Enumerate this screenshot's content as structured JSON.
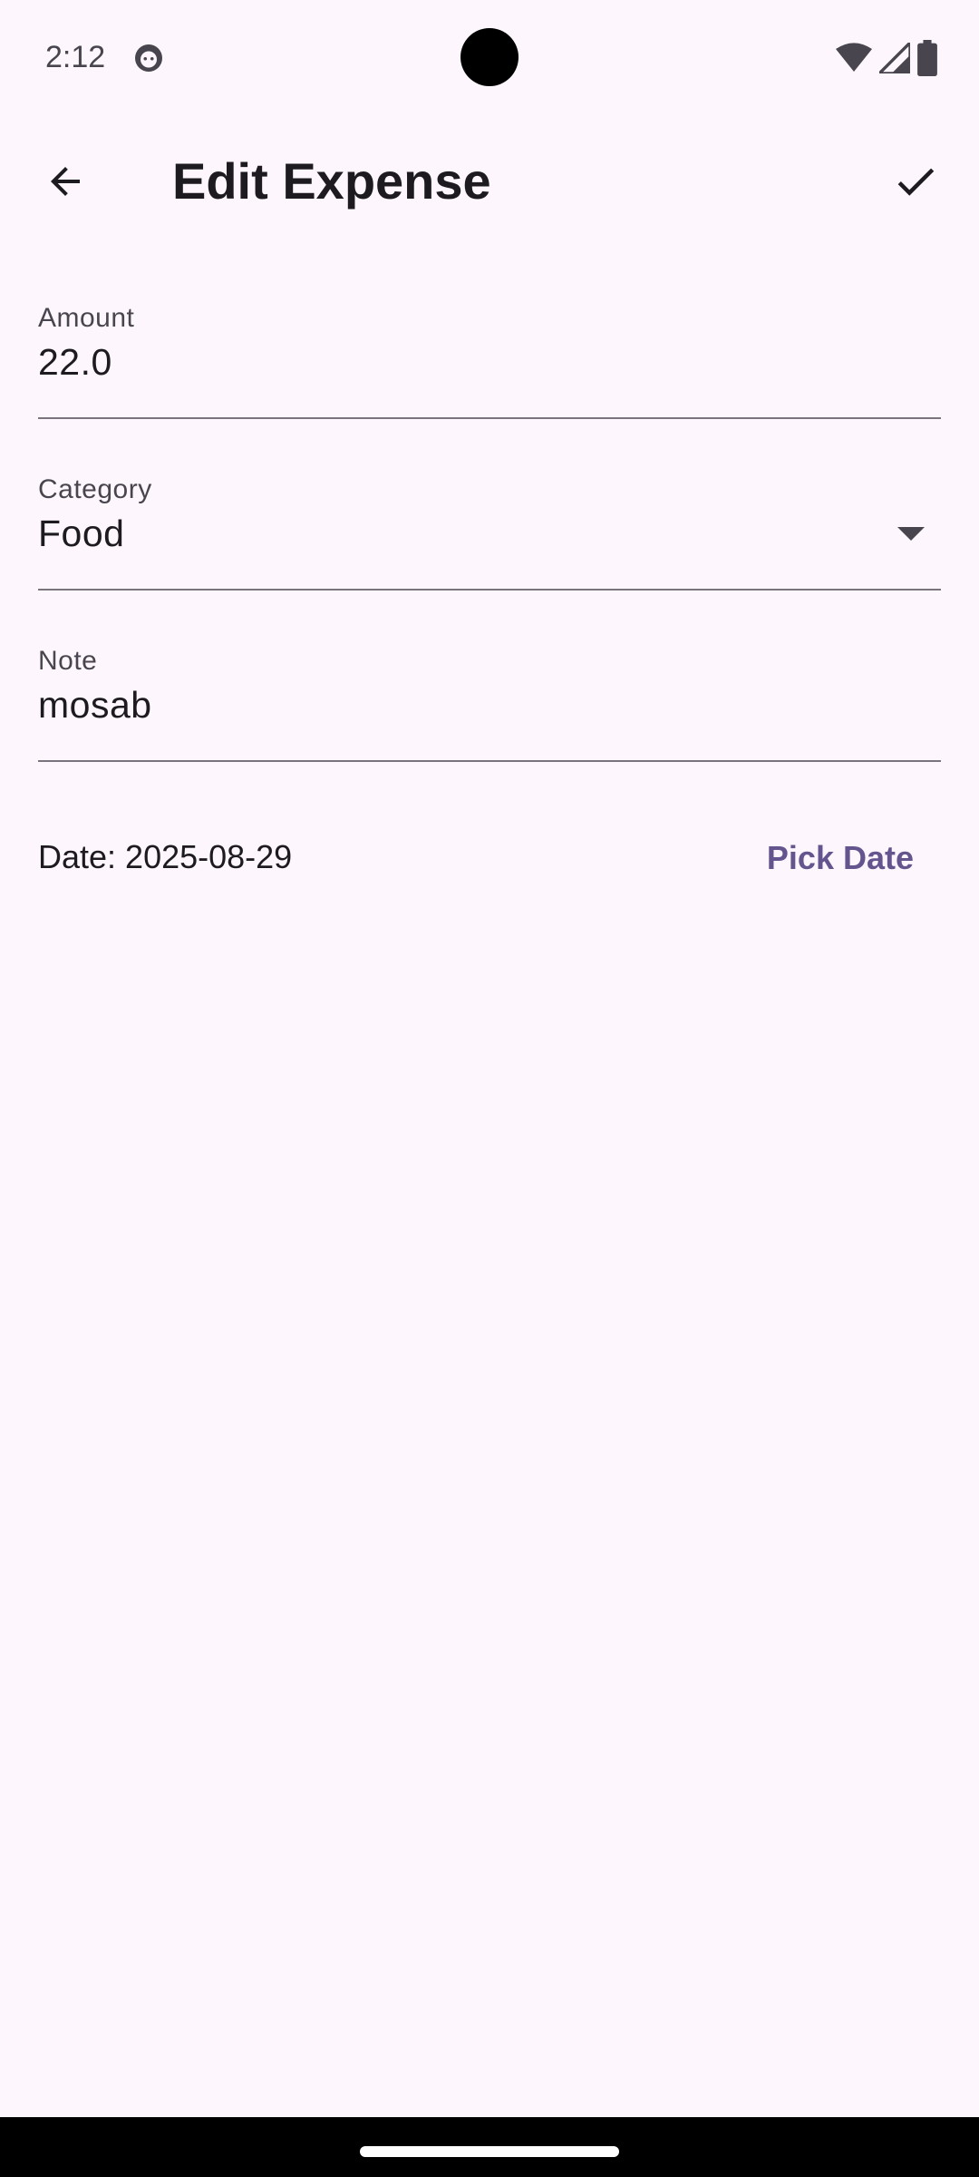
{
  "status_bar": {
    "time": "2:12"
  },
  "app_bar": {
    "title": "Edit Expense"
  },
  "form": {
    "amount": {
      "label": "Amount",
      "value": "22.0"
    },
    "category": {
      "label": "Category",
      "value": "Food"
    },
    "note": {
      "label": "Note",
      "value": "mosab"
    },
    "date": {
      "text": "Date: 2025-08-29",
      "pick_label": "Pick Date"
    }
  },
  "colors": {
    "background": "#fdf7fd",
    "accent": "#65558f",
    "text": "#1d1b20",
    "secondary_text": "#49454f",
    "underline": "#79747e"
  },
  "icons": {
    "back": "arrow-back-icon",
    "save": "check-icon",
    "dropdown": "dropdown-arrow-icon",
    "wifi": "wifi-icon",
    "signal": "signal-icon",
    "battery": "battery-icon"
  }
}
